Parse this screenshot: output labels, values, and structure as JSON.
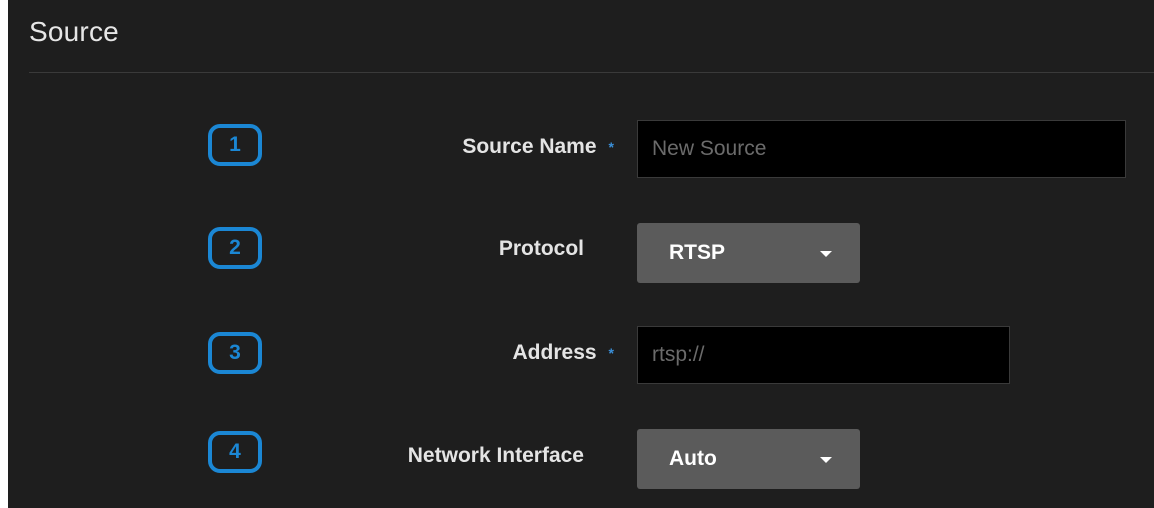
{
  "panel": {
    "title": "Source"
  },
  "fields": [
    {
      "step": "1",
      "label": "Source Name",
      "required_mark": "*",
      "type": "text",
      "value": "",
      "placeholder": "New Source"
    },
    {
      "step": "2",
      "label": "Protocol",
      "type": "select",
      "value": "RTSP"
    },
    {
      "step": "3",
      "label": "Address",
      "required_mark": "*",
      "type": "text",
      "value": "",
      "placeholder": "rtsp://"
    },
    {
      "step": "4",
      "label": "Network Interface",
      "type": "select",
      "value": "Auto"
    }
  ],
  "colors": {
    "background": "#1e1e1e",
    "accent": "#1b87d4",
    "select_background": "#5b5b5b",
    "input_background": "#000000"
  }
}
